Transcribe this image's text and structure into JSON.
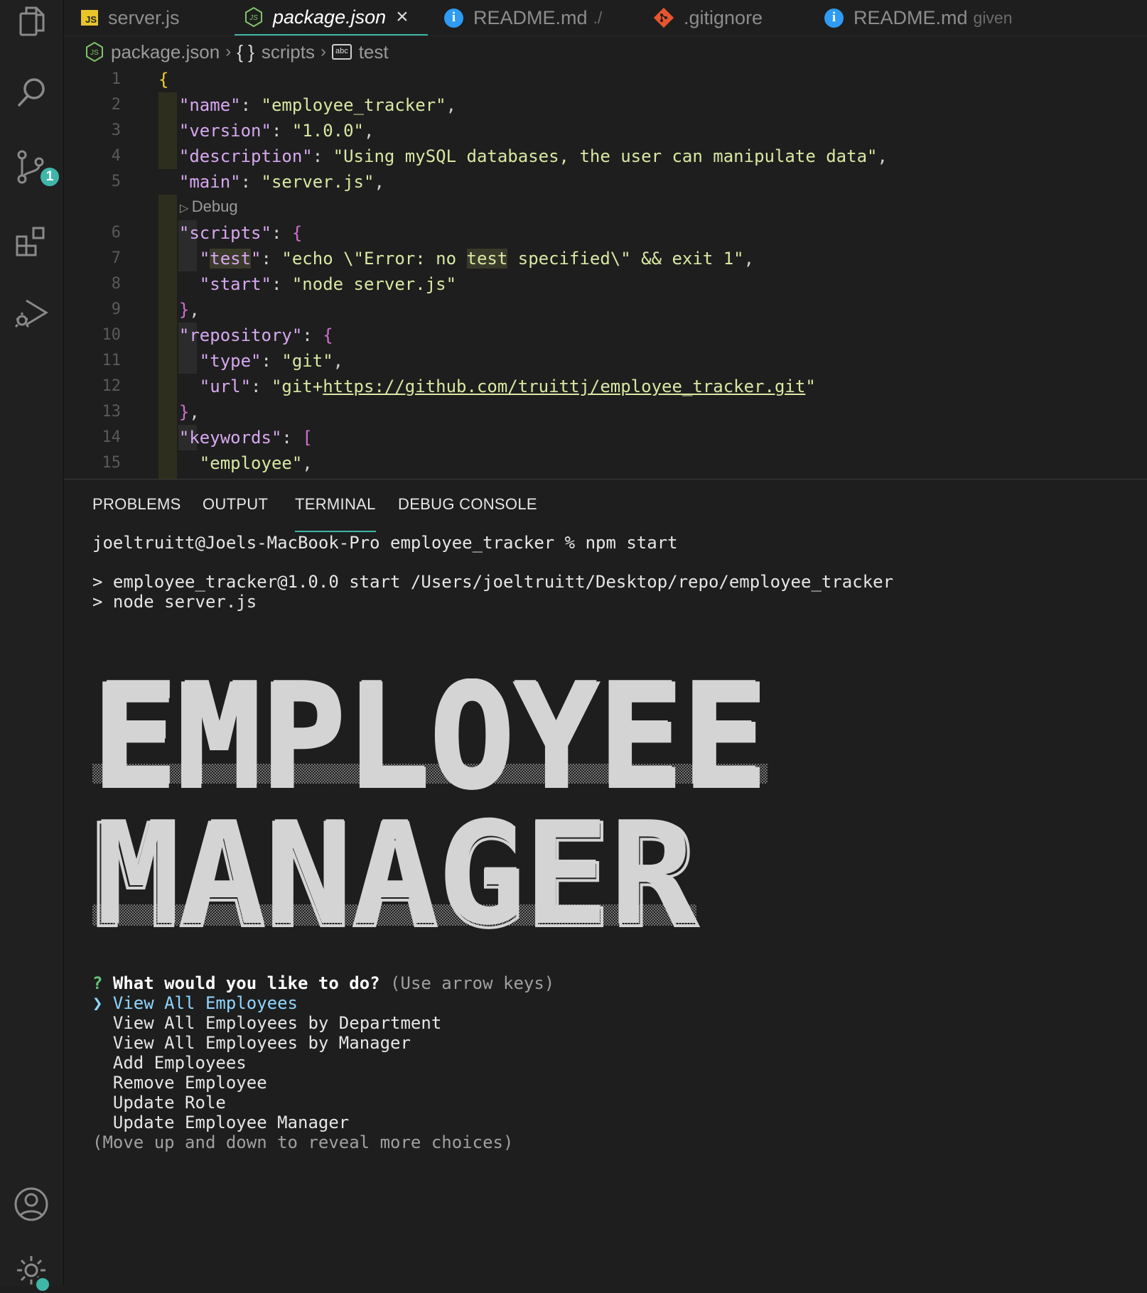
{
  "tabs": [
    {
      "label": "server.js",
      "icon": "js-file-icon"
    },
    {
      "label": "package.json",
      "icon": "nodejs-icon",
      "active": true
    },
    {
      "label": "README.md",
      "hint": "./",
      "icon": "info-icon"
    },
    {
      "label": ".gitignore",
      "icon": "git-icon"
    },
    {
      "label": "README.md",
      "hint": "given",
      "icon": "info-icon"
    }
  ],
  "breadcrumb": {
    "file": "package.json",
    "section": "scripts",
    "leaf": "test"
  },
  "activity": {
    "source_control_badge": "1"
  },
  "editor": {
    "lines": [
      "1",
      "2",
      "3",
      "4",
      "5",
      "6",
      "7",
      "8",
      "9",
      "10",
      "11",
      "12",
      "13",
      "14",
      "15"
    ],
    "codelens": "Debug",
    "name_key": "\"name\"",
    "name_val": "\"employee_tracker\"",
    "version_key": "\"version\"",
    "version_val": "\"1.0.0\"",
    "description_key": "\"description\"",
    "description_val": "\"Using mySQL databases, the user can manipulate data\"",
    "main_key": "\"main\"",
    "main_val": "\"server.js\"",
    "scripts_key": "\"scripts\"",
    "test_key": "test",
    "test_val_a": "\"echo \\\"Error: no ",
    "test_val_b": "test",
    "test_val_c": " specified\\\" && exit 1\"",
    "start_key": "\"start\"",
    "start_val": "\"node server.js\"",
    "repository_key": "\"repository\"",
    "type_key": "\"type\"",
    "type_val": "\"git\"",
    "url_key": "\"url\"",
    "url_prefix": "\"git+",
    "url_link": "https://github.com/truittj/employee_tracker.git",
    "url_suffix": "\"",
    "keywords_key": "\"keywords\"",
    "kw1": "\"employee\""
  },
  "panel_tabs": [
    "PROBLEMS",
    "OUTPUT",
    "TERMINAL",
    "DEBUG CONSOLE"
  ],
  "terminal": {
    "prompt": "joeltruitt@Joels-MacBook-Pro employee_tracker % npm start",
    "out1": "> employee_tracker@1.0.0 start /Users/joeltruitt/Desktop/repo/employee_tracker",
    "out2": "> node server.js",
    "banner_line1": "EMPLOYEE",
    "banner_line2": "MANAGER",
    "question_mark": "?",
    "question": "What would you like to do?",
    "question_hint": "(Use arrow keys)",
    "pointer": "❯",
    "choices": [
      "View All Employees",
      "View All Employees by Department",
      "View All Employees by Manager",
      "Add Employees",
      "Remove Employee",
      "Update Role",
      "Update Employee Manager"
    ],
    "footer": "(Move up and down to reveal more choices)"
  },
  "colors": {
    "accent": "#3fb6a8",
    "key": "#d7a8f0",
    "string": "#d8e8a2",
    "selection": "#8fd6ff",
    "question": "#64c27c"
  }
}
